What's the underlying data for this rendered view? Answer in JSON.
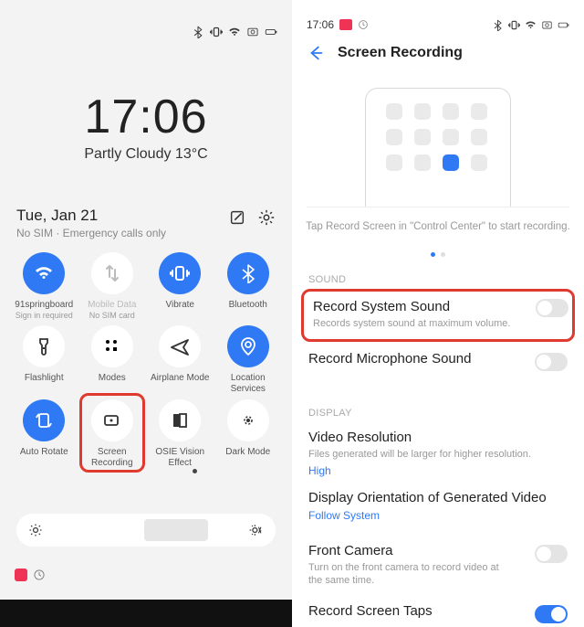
{
  "left": {
    "status_icons": [
      "bluetooth-icon",
      "vibrate-icon",
      "wifi-icon",
      "camera-box-icon",
      "battery-icon"
    ],
    "clock_time": "17:06",
    "weather": "Partly Cloudy 13°C",
    "date": "Tue, Jan 21",
    "sim_line": "No SIM · Emergency calls only",
    "edit_icon": "edit-icon",
    "settings_icon": "gear-icon",
    "tiles": [
      {
        "id": "wifi",
        "label": "91springboard",
        "sub": "Sign in required",
        "active": true,
        "icon": "wifi"
      },
      {
        "id": "mobile-data",
        "label": "Mobile Data",
        "sub": "No SIM card",
        "active": false,
        "dim": true,
        "icon": "swap"
      },
      {
        "id": "vibrate",
        "label": "Vibrate",
        "active": true,
        "icon": "vibrate"
      },
      {
        "id": "bluetooth",
        "label": "Bluetooth",
        "active": true,
        "icon": "bluetooth"
      },
      {
        "id": "flashlight",
        "label": "Flashlight",
        "active": false,
        "icon": "flashlight"
      },
      {
        "id": "modes",
        "label": "Modes",
        "active": false,
        "icon": "grid"
      },
      {
        "id": "airplane",
        "label": "Airplane Mode",
        "active": false,
        "icon": "airplane"
      },
      {
        "id": "location",
        "label": "Location Services",
        "active": true,
        "icon": "location"
      },
      {
        "id": "auto-rotate",
        "label": "Auto Rotate",
        "active": true,
        "icon": "rotate"
      },
      {
        "id": "screen-rec",
        "label": "Screen Recording",
        "active": false,
        "highlight": true,
        "icon": "camera"
      },
      {
        "id": "osie",
        "label": "OSIE Vision Effect",
        "active": false,
        "icon": "contrast"
      },
      {
        "id": "dark-mode",
        "label": "Dark Mode",
        "active": false,
        "icon": "darkmode"
      }
    ],
    "brightness_low": "brightness-low-icon",
    "brightness_auto": "brightness-auto-icon"
  },
  "right": {
    "status_time": "17:06",
    "status_icons": [
      "bluetooth-icon",
      "vibrate-icon",
      "wifi-icon",
      "camera-box-icon",
      "battery-icon"
    ],
    "page_title": "Screen Recording",
    "hint": "Tap Record Screen in \"Control Center\" to start recording.",
    "section_sound": "SOUND",
    "section_display": "DISPLAY",
    "settings": {
      "record_system": {
        "title": "Record System Sound",
        "sub": "Records system sound at maximum volume.",
        "on": false
      },
      "record_mic": {
        "title": "Record Microphone Sound",
        "on": false
      },
      "resolution": {
        "title": "Video Resolution",
        "sub": "Files generated will be larger for higher resolution.",
        "value": "High"
      },
      "orientation": {
        "title": "Display Orientation of Generated Video",
        "value": "Follow System"
      },
      "front_cam": {
        "title": "Front Camera",
        "sub": "Turn on the front camera to record video at the same time.",
        "on": false
      },
      "last": {
        "title": "Record Screen Taps",
        "on": true
      }
    }
  }
}
